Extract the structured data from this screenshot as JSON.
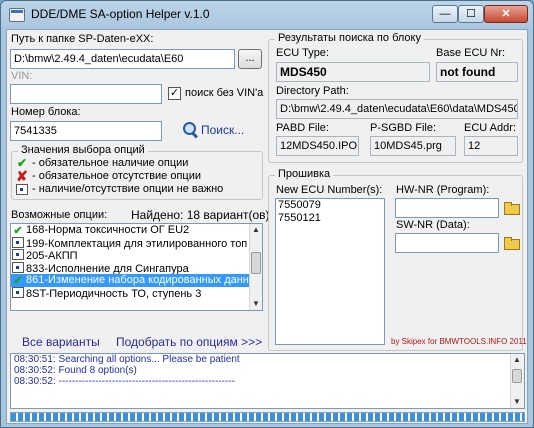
{
  "window": {
    "title": "DDE/DME SA-option Helper  v.1.0",
    "controls": {
      "minimize": "—",
      "maximize": "☐",
      "close": "✕"
    }
  },
  "left": {
    "path_label": "Путь к папке SP-Daten-eXX:",
    "path_value": "D:\\bmw\\2.49.4_daten\\ecudata\\E60",
    "browse_label": "...",
    "vin_label": "VIN:",
    "vin_value": "",
    "no_vin_search_label": "поиск без VIN'а",
    "no_vin_search_checked": true,
    "block_number_label": "Номер блока:",
    "block_number_value": "7541335",
    "search_label": "Поиск..."
  },
  "legend": {
    "title": "Значения выбора опций",
    "items": [
      {
        "icon": "check-icon",
        "text": "- обязательное наличие опции"
      },
      {
        "icon": "cross-icon",
        "text": "- обязательное отсутствие опции"
      },
      {
        "icon": "dot-icon",
        "text": "- наличие/отсутствие опции не важно"
      }
    ]
  },
  "options": {
    "label": "Возможные опции:",
    "found_text": "Найдено: 18 вариант(ов)",
    "items": [
      {
        "status": "check",
        "text": "168-Норма токсичности ОГ EU2",
        "selected": false
      },
      {
        "status": "dot",
        "text": "199-Комплектация для этилированного топ",
        "selected": false
      },
      {
        "status": "dot",
        "text": "205-АКПП",
        "selected": false
      },
      {
        "status": "dot",
        "text": "833-Исполнение для Сингапура",
        "selected": false
      },
      {
        "status": "check",
        "text": "861-Изменение набора кодированных данн",
        "selected": true
      },
      {
        "status": "dot",
        "text": "8ST-Периодичность ТО, ступень 3",
        "selected": false
      }
    ],
    "all_variants_link": "Все варианты",
    "match_link": "Подобрать по опциям >>>"
  },
  "results": {
    "title": "Результаты поиска по блоку",
    "ecu_type_label": "ECU Type:",
    "ecu_type_value": "MDS450",
    "base_ecu_label": "Base ECU Nr:",
    "base_ecu_value": "not found",
    "dir_label": "Directory Path:",
    "dir_value": "D:\\bmw\\2.49.4_daten\\ecudata\\E60\\data\\MDS450",
    "pabd_label": "PABD File:",
    "pabd_value": "12MDS450.IPO",
    "psgbd_label": "P-SGBD File:",
    "psgbd_value": "10MDS45.prg",
    "addr_label": "ECU Addr:",
    "addr_value": "12"
  },
  "firmware": {
    "title": "Прошивка",
    "new_ecu_label": "New ECU Number(s):",
    "new_ecu_items": [
      "7550079",
      "7550121"
    ],
    "hw_label": "HW-NR (Program):",
    "hw_value": "",
    "sw_label": "SW-NR (Data):",
    "sw_value": "",
    "credit": "by Skipex for BMWTOOLS.INFO 2011"
  },
  "log": {
    "lines": [
      "08:30:51:  Searching all options... Please be patient",
      "08:30:52:  Found 8 option(s)",
      "08:30:52:  -----------------------------------------------------",
      ""
    ]
  },
  "progress": {
    "fraction": 1.0
  },
  "colors": {
    "selection": "#3399ff",
    "log_text": "#2030b0",
    "credit": "#b01818"
  }
}
